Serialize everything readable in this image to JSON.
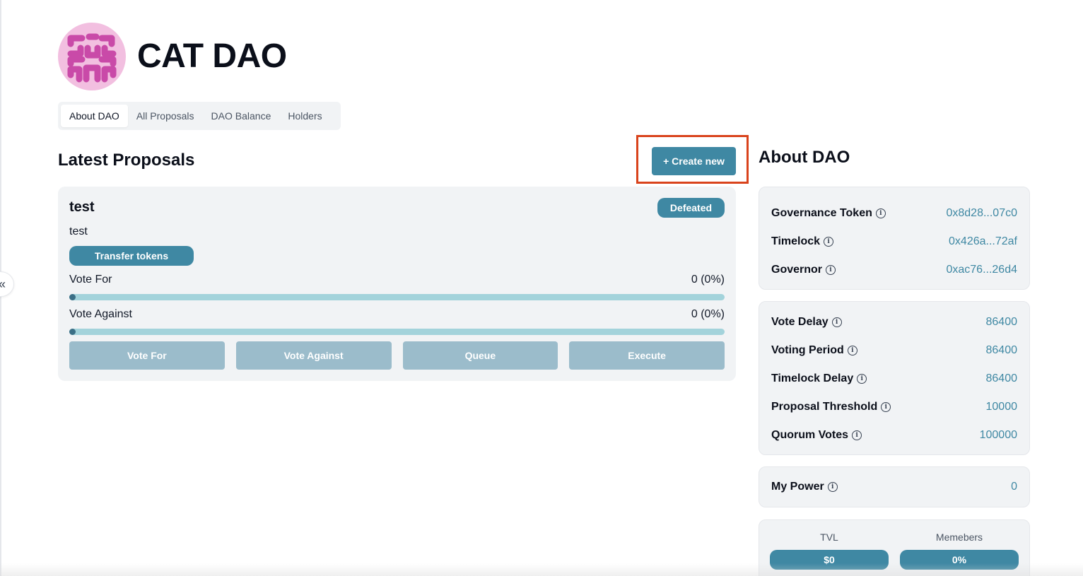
{
  "header": {
    "dao_name": "CAT DAO",
    "avatar_icon": "cat-dao-logo"
  },
  "tabs": [
    {
      "label": "About DAO",
      "active": true
    },
    {
      "label": "All Proposals",
      "active": false
    },
    {
      "label": "DAO Balance",
      "active": false
    },
    {
      "label": "Holders",
      "active": false
    }
  ],
  "proposals_section": {
    "title": "Latest Proposals",
    "create_button_label": "+ Create new"
  },
  "proposal": {
    "title": "test",
    "status": "Defeated",
    "description": "test",
    "tag": "Transfer tokens",
    "vote_for": {
      "label": "Vote For",
      "value": "0 (0%)",
      "percent": 0
    },
    "vote_against": {
      "label": "Vote Against",
      "value": "0 (0%)",
      "percent": 0
    },
    "actions": [
      "Vote For",
      "Vote Against",
      "Queue",
      "Execute"
    ]
  },
  "about": {
    "title": "About DAO",
    "addresses": [
      {
        "label": "Governance Token",
        "value": "0x8d28...07c0"
      },
      {
        "label": "Timelock",
        "value": "0x426a...72af"
      },
      {
        "label": "Governor",
        "value": "0xac76...26d4"
      }
    ],
    "params": [
      {
        "label": "Vote Delay",
        "value": "86400"
      },
      {
        "label": "Voting Period",
        "value": "86400"
      },
      {
        "label": "Timelock Delay",
        "value": "86400"
      },
      {
        "label": "Proposal Threshold",
        "value": "10000"
      },
      {
        "label": "Quorum Votes",
        "value": "100000"
      }
    ],
    "power": {
      "label": "My Power",
      "value": "0"
    },
    "stats": [
      {
        "label": "TVL",
        "value": "$0"
      },
      {
        "label": "Memebers",
        "value": "0%"
      }
    ]
  },
  "colors": {
    "accent": "#3f88a3",
    "highlight": "#d9431c",
    "panel_bg": "#f1f3f5",
    "disabled_button": "#9bbccb",
    "progress_track": "#a3d3db"
  },
  "icons": {
    "collapse": "chevrons-left-icon",
    "info": "info-icon"
  }
}
